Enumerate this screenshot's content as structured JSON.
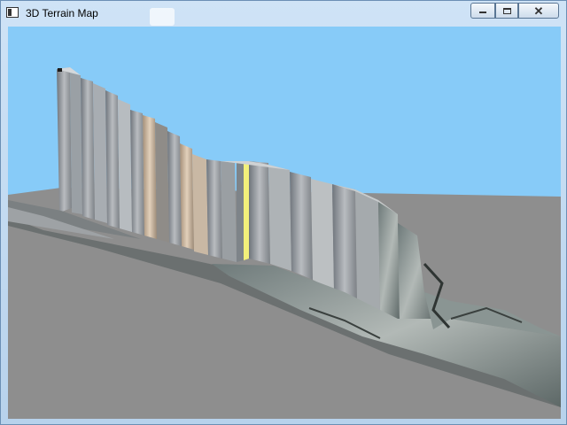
{
  "window": {
    "title": "3D Terrain Map",
    "controls": {
      "minimize": "minimize-icon",
      "maximize": "maximize-icon",
      "close": "close-icon"
    }
  },
  "scene": {
    "sky_color": "#87CBF8",
    "ground_color": "#8E8E8E",
    "highlight_color": "#F2F07A"
  }
}
